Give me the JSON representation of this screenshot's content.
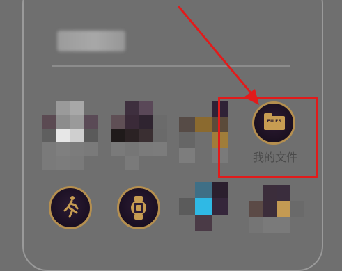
{
  "highlighted_app": {
    "icon_text": "FILES",
    "label": "我的文件"
  },
  "colors": {
    "background": "#6f6f6f",
    "highlight": "#e11b1b",
    "gold": "#b58f4f",
    "icon_bg": "#1b1020"
  },
  "icons": {
    "files": "folder-icon",
    "runner": "runner-icon",
    "watch": "watch-icon"
  }
}
